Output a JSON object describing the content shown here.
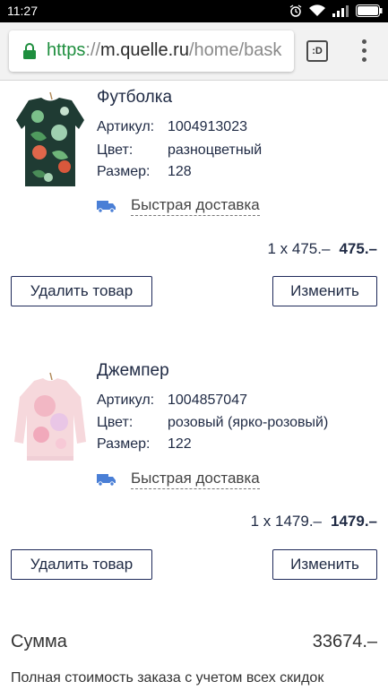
{
  "status_bar": {
    "time": "11:27",
    "icons": [
      "alarm-icon",
      "wifi-icon",
      "signal-icon",
      "battery-icon"
    ]
  },
  "browser": {
    "url_scheme": "https",
    "url_separator": "://",
    "url_host": "m.quelle.ru",
    "url_path": "/home/bask",
    "tabs_label": ":D",
    "colors": {
      "secure": "#1e8e3e",
      "chrome": "#f2f2f2"
    }
  },
  "products": [
    {
      "title": "Футболка",
      "image_icon": "tshirt-tropical-print-image",
      "article_label": "Артикул:",
      "article": "1004913023",
      "color_label": "Цвет:",
      "color": "разноцветный",
      "size_label": "Размер:",
      "size": "128",
      "delivery": "Быстрая доставка",
      "qty_price": "1 x 475.–",
      "total": "475.–",
      "delete_label": "Удалить товар",
      "change_label": "Изменить"
    },
    {
      "title": "Джемпер",
      "image_icon": "pink-jumper-image",
      "article_label": "Артикул:",
      "article": "1004857047",
      "color_label": "Цвет:",
      "color": "розовый (ярко-розовый)",
      "size_label": "Размер:",
      "size": "122",
      "delivery": "Быстрая доставка",
      "qty_price": "1 x 1479.–",
      "total": "1479.–",
      "delete_label": "Удалить товар",
      "change_label": "Изменить"
    }
  ],
  "summary": {
    "label": "Сумма",
    "value": "33674.–",
    "note": "Полная стоимость заказа с учетом всех скидок"
  },
  "colors": {
    "text_primary": "#1f2a44",
    "button_border": "#1f2a5a",
    "delivery_icon": "#4a7fd6"
  }
}
